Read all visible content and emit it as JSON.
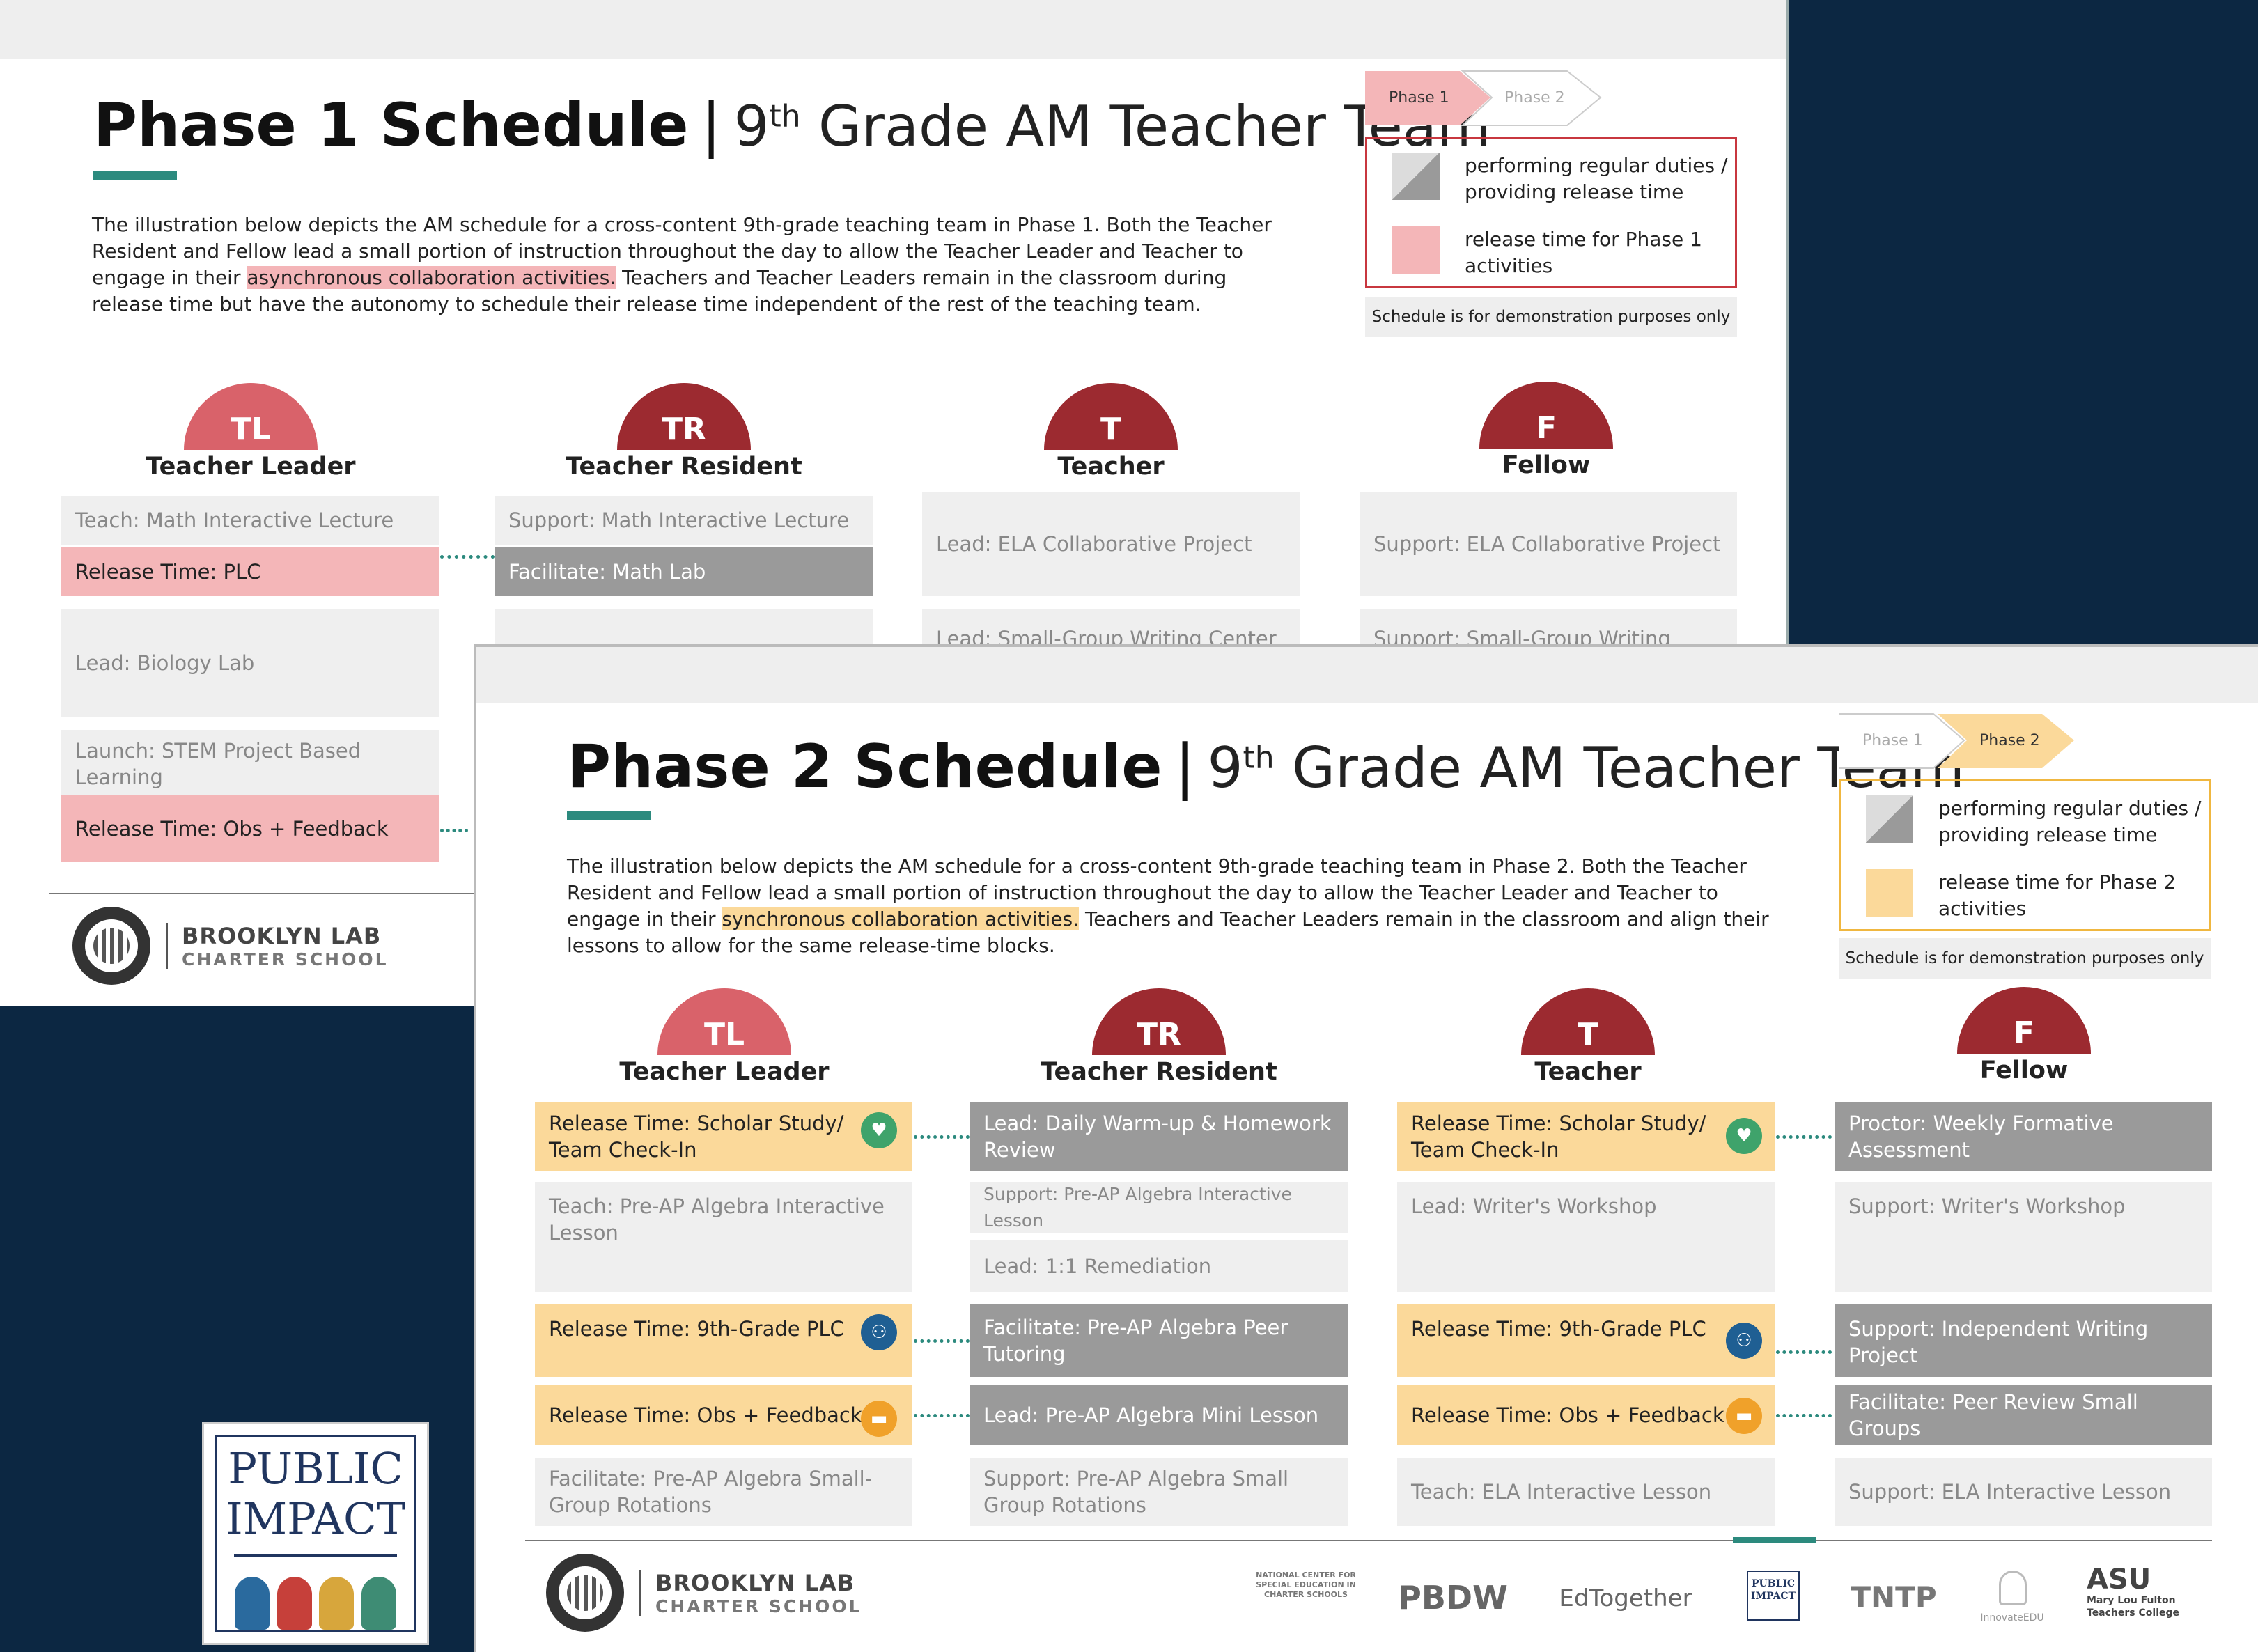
{
  "slide1": {
    "title_bold": "Phase 1 Schedule",
    "title_sep": "|",
    "title_pre": "9",
    "title_sup": "th",
    "title_post": " Grade AM Teacher Team",
    "intro_a": "The illustration below depicts the AM schedule for a cross-content 9th-grade teaching team in Phase 1. Both the Teacher Resident and Fellow lead a small portion of instruction throughout the day to allow the Teacher Leader and Teacher to engage in their ",
    "intro_hl": "asynchronous collaboration activities.",
    "intro_b": " Teachers and Teacher Leaders remain in the classroom during release time but have the autonomy to schedule their release time independent of the rest of the teaching team.",
    "phase_active": "Phase 1",
    "phase_inactive": "Phase 2",
    "legend_regular": "performing regular duties / providing release time",
    "legend_release": "release time for Phase 1 activities",
    "demo_note": "Schedule is for demonstration purposes only",
    "roles": [
      {
        "abbr": "TL",
        "name": "Teacher Leader"
      },
      {
        "abbr": "TR",
        "name": "Teacher Resident"
      },
      {
        "abbr": "T",
        "name": "Teacher"
      },
      {
        "abbr": "F",
        "name": "Fellow"
      }
    ],
    "tl_cells": [
      "Teach: Math Interactive Lecture",
      "Release Time: PLC",
      "Lead: Biology Lab",
      "Launch: STEM Project Based Learning",
      "Release Time: Obs + Feedback"
    ],
    "tr_cells": [
      "Support: Math Interactive Lecture",
      "Facilitate: Math Lab"
    ],
    "t_cells": [
      "Lead: ELA Collaborative Project",
      "Lead: Small-Group Writing Center"
    ],
    "f_cells": [
      "Support: ELA Collaborative Project",
      "Support: Small-Group Writing Center"
    ],
    "logo_line1": "BROOKLYN LAB",
    "logo_line2": "CHARTER SCHOOL",
    "colors": {
      "tl": "#d9626a",
      "others": "#9c2a30",
      "pink": "#f4b6b8"
    }
  },
  "slide2": {
    "title_bold": "Phase 2 Schedule",
    "title_sep": "|",
    "title_pre": "9",
    "title_sup": "th",
    "title_post": " Grade AM Teacher Team",
    "intro_a": "The illustration below depicts the AM schedule for a cross-content 9th-grade teaching team in Phase 2. Both the Teacher Resident and Fellow lead a small portion of instruction throughout the day to allow the Teacher Leader and Teacher to engage in their ",
    "intro_hl": "synchronous collaboration activities.",
    "intro_b": " Teachers and Teacher Leaders remain in the classroom and align their lessons to allow for the same release-time blocks.",
    "phase_inactive": "Phase 1",
    "phase_active": "Phase 2",
    "legend_regular": "performing regular duties / providing release time",
    "legend_release": "release time for Phase 2 activities",
    "demo_note": "Schedule is for demonstration purposes only",
    "roles": [
      {
        "abbr": "TL",
        "name": "Teacher Leader"
      },
      {
        "abbr": "TR",
        "name": "Teacher Resident"
      },
      {
        "abbr": "T",
        "name": "Teacher"
      },
      {
        "abbr": "F",
        "name": "Fellow"
      }
    ],
    "tl_cells": [
      "Release Time: Scholar Study/ Team Check-In",
      "Teach: Pre-AP Algebra Interactive Lesson",
      "Release Time: 9th-Grade PLC",
      "Release Time: Obs + Feedback",
      "Facilitate: Pre-AP Algebra Small-Group Rotations"
    ],
    "tr_cells": [
      "Lead: Daily Warm-up & Homework Review",
      "Support: Pre-AP Algebra Interactive Lesson",
      "Lead: 1:1 Remediation",
      "Facilitate: Pre-AP Algebra Peer Tutoring",
      "Lead: Pre-AP Algebra Mini Lesson",
      "Support: Pre-AP Algebra Small Group Rotations"
    ],
    "t_cells": [
      "Release Time: Scholar Study/ Team Check-In",
      "Lead: Writer's Workshop",
      "Release Time: 9th-Grade PLC",
      "Release Time: Obs + Feedback",
      "Teach: ELA Interactive Lesson"
    ],
    "f_cells": [
      "Proctor: Weekly Formative Assessment",
      "Support: Writer's Workshop",
      "Support: Independent Writing Project",
      "Facilitate: Peer Review Small Groups",
      "Support: ELA Interactive Lesson"
    ],
    "logo_line1": "BROOKLYN LAB",
    "logo_line2": "CHARTER SCHOOL",
    "sponsors": {
      "ncse": "NATIONAL CENTER FOR SPECIAL EDUCATION IN CHARTER SCHOOLS",
      "pbdw": "PBDW",
      "edtogether": "EdTogether",
      "pi_small": "PUBLIC IMPACT",
      "tntp": "TNTP",
      "innovate": "InnovateEDU",
      "asu_1": "ASU",
      "asu_2": "Mary Lou Fulton Teachers College"
    },
    "colors": {
      "gold": "#fbd99a",
      "gray": "#9a9a9a",
      "teal": "#2c8a7e",
      "green_icon": "#3fa36b",
      "blue_icon": "#1f5f93",
      "orange_icon": "#f0a12a"
    }
  },
  "badge": {
    "line1": "PUBLIC",
    "line2": "IMPACT"
  }
}
